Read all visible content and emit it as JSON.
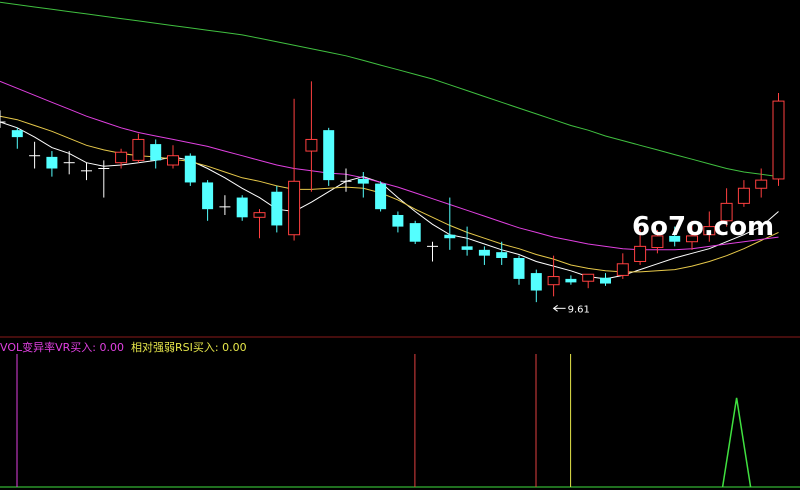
{
  "chart_data": {
    "type": "candlestick",
    "candles": [
      {
        "o": 10.95,
        "c": 10.95,
        "h": 11.05,
        "l": 10.9,
        "dir": "doji"
      },
      {
        "o": 10.88,
        "c": 10.82,
        "h": 10.9,
        "l": 10.72,
        "dir": "down"
      },
      {
        "o": 10.66,
        "c": 10.66,
        "h": 10.78,
        "l": 10.55,
        "dir": "doji"
      },
      {
        "o": 10.65,
        "c": 10.55,
        "h": 10.7,
        "l": 10.48,
        "dir": "down"
      },
      {
        "o": 10.6,
        "c": 10.6,
        "h": 10.7,
        "l": 10.5,
        "dir": "doji"
      },
      {
        "o": 10.53,
        "c": 10.53,
        "h": 10.6,
        "l": 10.45,
        "dir": "doji"
      },
      {
        "o": 10.55,
        "c": 10.55,
        "h": 10.62,
        "l": 10.3,
        "dir": "doji"
      },
      {
        "o": 10.6,
        "c": 10.69,
        "h": 10.72,
        "l": 10.55,
        "dir": "up"
      },
      {
        "o": 10.62,
        "c": 10.8,
        "h": 10.85,
        "l": 10.6,
        "dir": "up"
      },
      {
        "o": 10.76,
        "c": 10.62,
        "h": 10.8,
        "l": 10.55,
        "dir": "down"
      },
      {
        "o": 10.58,
        "c": 10.66,
        "h": 10.75,
        "l": 10.55,
        "dir": "up"
      },
      {
        "o": 10.66,
        "c": 10.43,
        "h": 10.68,
        "l": 10.4,
        "dir": "down"
      },
      {
        "o": 10.43,
        "c": 10.2,
        "h": 10.45,
        "l": 10.1,
        "dir": "down"
      },
      {
        "o": 10.22,
        "c": 10.22,
        "h": 10.32,
        "l": 10.15,
        "dir": "doji"
      },
      {
        "o": 10.3,
        "c": 10.13,
        "h": 10.32,
        "l": 10.1,
        "dir": "down"
      },
      {
        "o": 10.13,
        "c": 10.17,
        "h": 10.2,
        "l": 9.95,
        "dir": "up"
      },
      {
        "o": 10.35,
        "c": 10.06,
        "h": 10.4,
        "l": 10.0,
        "dir": "down"
      },
      {
        "o": 9.98,
        "c": 10.44,
        "h": 11.15,
        "l": 9.93,
        "dir": "up"
      },
      {
        "o": 10.7,
        "c": 10.8,
        "h": 11.3,
        "l": 10.35,
        "dir": "up"
      },
      {
        "o": 10.88,
        "c": 10.45,
        "h": 10.9,
        "l": 10.4,
        "dir": "down"
      },
      {
        "o": 10.44,
        "c": 10.44,
        "h": 10.55,
        "l": 10.35,
        "dir": "doji"
      },
      {
        "o": 10.46,
        "c": 10.42,
        "h": 10.52,
        "l": 10.3,
        "dir": "down"
      },
      {
        "o": 10.42,
        "c": 10.2,
        "h": 10.44,
        "l": 10.18,
        "dir": "down"
      },
      {
        "o": 10.15,
        "c": 10.05,
        "h": 10.18,
        "l": 10.0,
        "dir": "down"
      },
      {
        "o": 10.08,
        "c": 9.92,
        "h": 10.1,
        "l": 9.9,
        "dir": "down"
      },
      {
        "o": 9.88,
        "c": 9.88,
        "h": 9.92,
        "l": 9.75,
        "dir": "doji"
      },
      {
        "o": 9.98,
        "c": 9.95,
        "h": 10.3,
        "l": 9.85,
        "dir": "down"
      },
      {
        "o": 9.88,
        "c": 9.85,
        "h": 10.05,
        "l": 9.8,
        "dir": "down"
      },
      {
        "o": 9.85,
        "c": 9.8,
        "h": 9.88,
        "l": 9.72,
        "dir": "down"
      },
      {
        "o": 9.83,
        "c": 9.78,
        "h": 9.92,
        "l": 9.72,
        "dir": "down"
      },
      {
        "o": 9.78,
        "c": 9.6,
        "h": 9.8,
        "l": 9.55,
        "dir": "down"
      },
      {
        "o": 9.65,
        "c": 9.5,
        "h": 9.68,
        "l": 9.4,
        "dir": "down"
      },
      {
        "o": 9.55,
        "c": 9.62,
        "h": 9.8,
        "l": 9.45,
        "dir": "up"
      },
      {
        "o": 9.6,
        "c": 9.57,
        "h": 9.63,
        "l": 9.55,
        "dir": "down"
      },
      {
        "o": 9.58,
        "c": 9.64,
        "h": 9.64,
        "l": 9.52,
        "dir": "up"
      },
      {
        "o": 9.56,
        "c": 9.61,
        "h": 9.65,
        "l": 9.54,
        "dir": "down"
      },
      {
        "o": 9.63,
        "c": 9.73,
        "h": 9.82,
        "l": 9.6,
        "dir": "up"
      },
      {
        "o": 9.75,
        "c": 9.88,
        "h": 10.03,
        "l": 9.72,
        "dir": "up"
      },
      {
        "o": 9.87,
        "c": 9.97,
        "h": 10.02,
        "l": 9.82,
        "dir": "up"
      },
      {
        "o": 9.97,
        "c": 9.92,
        "h": 10.05,
        "l": 9.88,
        "dir": "down"
      },
      {
        "o": 9.92,
        "c": 9.97,
        "h": 10.1,
        "l": 9.85,
        "dir": "up"
      },
      {
        "o": 9.98,
        "c": 10.05,
        "h": 10.18,
        "l": 9.92,
        "dir": "up"
      },
      {
        "o": 10.1,
        "c": 10.25,
        "h": 10.38,
        "l": 10.05,
        "dir": "up"
      },
      {
        "o": 10.25,
        "c": 10.38,
        "h": 10.45,
        "l": 10.22,
        "dir": "up"
      },
      {
        "o": 10.38,
        "c": 10.45,
        "h": 10.55,
        "l": 10.3,
        "dir": "up"
      },
      {
        "o": 10.46,
        "c": 11.13,
        "h": 11.2,
        "l": 10.4,
        "dir": "up"
      }
    ],
    "ma_lines": [
      {
        "color": "#ffffff",
        "values": [
          10.95,
          10.9,
          10.82,
          10.73,
          10.68,
          10.6,
          10.57,
          10.58,
          10.6,
          10.62,
          10.65,
          10.62,
          10.55,
          10.47,
          10.38,
          10.3,
          10.2,
          10.18,
          10.26,
          10.35,
          10.44,
          10.48,
          10.43,
          10.3,
          10.18,
          10.07,
          9.98,
          9.95,
          9.9,
          9.85,
          9.81,
          9.75,
          9.71,
          9.67,
          9.62,
          9.6,
          9.63,
          9.68,
          9.73,
          9.78,
          9.82,
          9.86,
          9.92,
          9.98,
          10.05,
          10.18
        ]
      },
      {
        "color": "#e6c84a",
        "values": [
          11.0,
          10.97,
          10.92,
          10.87,
          10.81,
          10.75,
          10.71,
          10.68,
          10.66,
          10.65,
          10.63,
          10.61,
          10.57,
          10.52,
          10.47,
          10.44,
          10.4,
          10.37,
          10.37,
          10.38,
          10.39,
          10.38,
          10.34,
          10.28,
          10.2,
          10.13,
          10.06,
          10.0,
          9.95,
          9.9,
          9.86,
          9.81,
          9.77,
          9.72,
          9.69,
          9.67,
          9.66,
          9.66,
          9.67,
          9.68,
          9.71,
          9.75,
          9.8,
          9.86,
          9.93,
          10.0
        ]
      },
      {
        "color": "#e040e0",
        "values": [
          11.3,
          11.24,
          11.18,
          11.12,
          11.06,
          11.0,
          10.95,
          10.9,
          10.86,
          10.83,
          10.8,
          10.77,
          10.74,
          10.7,
          10.66,
          10.62,
          10.58,
          10.55,
          10.53,
          10.51,
          10.5,
          10.47,
          10.43,
          10.39,
          10.34,
          10.29,
          10.24,
          10.19,
          10.14,
          10.09,
          10.04,
          10.0,
          9.96,
          9.93,
          9.9,
          9.88,
          9.86,
          9.85,
          9.85,
          9.85,
          9.86,
          9.88,
          9.9,
          9.92,
          9.94,
          9.96
        ]
      },
      {
        "color": "#40c040",
        "values": [
          11.98,
          11.96,
          11.94,
          11.92,
          11.9,
          11.88,
          11.86,
          11.84,
          11.82,
          11.8,
          11.78,
          11.76,
          11.74,
          11.72,
          11.7,
          11.67,
          11.64,
          11.61,
          11.58,
          11.55,
          11.52,
          11.48,
          11.44,
          11.4,
          11.36,
          11.32,
          11.27,
          11.22,
          11.17,
          11.12,
          11.07,
          11.02,
          10.97,
          10.92,
          10.88,
          10.83,
          10.79,
          10.75,
          10.71,
          10.67,
          10.63,
          10.59,
          10.55,
          10.52,
          10.5,
          10.48
        ]
      }
    ],
    "price_range": [
      9.1,
      12.0
    ],
    "low_marker": {
      "index": 32,
      "label": "9.61"
    },
    "indicator_panel": {
      "labels": [
        {
          "text": "VOL变异率VR买入: 0.00",
          "color": "#e040e0"
        },
        {
          "text": "相对强弱RSI买入: 0.00",
          "color": "#e6e64a"
        }
      ],
      "spikes": [
        {
          "index": 0,
          "color": "#e040e0",
          "height": 1.0
        },
        {
          "index": 23,
          "color": "#e04040",
          "height": 1.0
        },
        {
          "index": 30,
          "color": "#e04040",
          "height": 1.0
        },
        {
          "index": 32,
          "color": "#e6e64a",
          "height": 1.0
        }
      ],
      "triangle": {
        "index": 42,
        "color": "#40e040",
        "height": 0.67
      }
    },
    "colors": {
      "up": "#ff4040",
      "down": "#54ffff",
      "doji": "#ffffff",
      "divider": "#8a1a1a"
    }
  },
  "watermark": "6o7o.com"
}
